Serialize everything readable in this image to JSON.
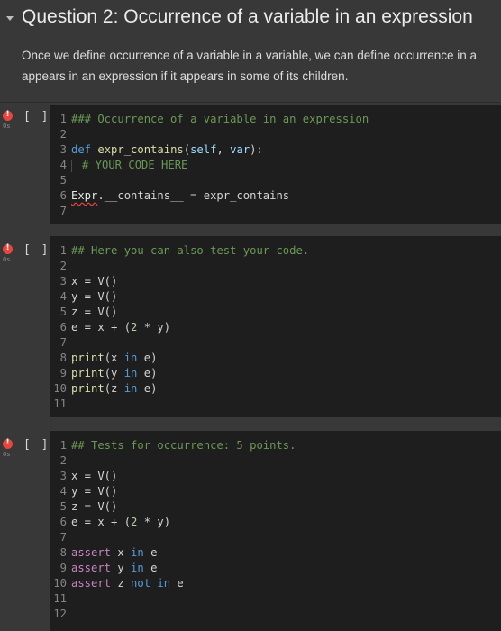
{
  "heading": {
    "title": "Question 2: Occurrence of a variable in an expression",
    "desc_line1": "Once we define occurrence of a variable in a variable, we can define occurrence in a",
    "desc_line2": "appears in an expression if it appears in some of its children."
  },
  "cells": [
    {
      "bracket": "[ ]",
      "time": "0s",
      "lines": [
        {
          "n": "1",
          "tokens": [
            {
              "t": "### Occurrence of a variable in an expression",
              "c": "comment"
            }
          ]
        },
        {
          "n": "2",
          "tokens": []
        },
        {
          "n": "3",
          "tokens": [
            {
              "t": "def ",
              "c": "def"
            },
            {
              "t": "expr_contains",
              "c": "fn"
            },
            {
              "t": "(",
              "c": "plain"
            },
            {
              "t": "self",
              "c": "self"
            },
            {
              "t": ", ",
              "c": "plain"
            },
            {
              "t": "var",
              "c": "self"
            },
            {
              "t": "):",
              "c": "plain"
            }
          ]
        },
        {
          "n": "4",
          "indent": true,
          "tokens": [
            {
              "t": "# YOUR CODE HERE",
              "c": "comment"
            }
          ]
        },
        {
          "n": "5",
          "tokens": []
        },
        {
          "n": "6",
          "tokens": [
            {
              "t": "Expr",
              "c": "squiggle"
            },
            {
              "t": ".__contains__ = expr_contains",
              "c": "plain"
            }
          ]
        },
        {
          "n": "7",
          "tokens": []
        }
      ]
    },
    {
      "bracket": "[ ]",
      "time": "0s",
      "lines": [
        {
          "n": "1",
          "tokens": [
            {
              "t": "## Here you can also test your code.",
              "c": "comment"
            }
          ]
        },
        {
          "n": "2",
          "tokens": []
        },
        {
          "n": "3",
          "tokens": [
            {
              "t": "x = V()",
              "c": "plain"
            }
          ]
        },
        {
          "n": "4",
          "tokens": [
            {
              "t": "y = V()",
              "c": "plain"
            }
          ]
        },
        {
          "n": "5",
          "tokens": [
            {
              "t": "z = V()",
              "c": "plain"
            }
          ]
        },
        {
          "n": "6",
          "tokens": [
            {
              "t": "e = x + (",
              "c": "plain"
            },
            {
              "t": "2",
              "c": "num"
            },
            {
              "t": " * y)",
              "c": "plain"
            }
          ]
        },
        {
          "n": "7",
          "tokens": []
        },
        {
          "n": "8",
          "tokens": [
            {
              "t": "print",
              "c": "fn"
            },
            {
              "t": "(x ",
              "c": "plain"
            },
            {
              "t": "in",
              "c": "def"
            },
            {
              "t": " e)",
              "c": "plain"
            }
          ]
        },
        {
          "n": "9",
          "tokens": [
            {
              "t": "print",
              "c": "fn"
            },
            {
              "t": "(y ",
              "c": "plain"
            },
            {
              "t": "in",
              "c": "def"
            },
            {
              "t": " e)",
              "c": "plain"
            }
          ]
        },
        {
          "n": "10",
          "tokens": [
            {
              "t": "print",
              "c": "fn"
            },
            {
              "t": "(z ",
              "c": "plain"
            },
            {
              "t": "in",
              "c": "def"
            },
            {
              "t": " e)",
              "c": "plain"
            }
          ]
        },
        {
          "n": "11",
          "tokens": []
        }
      ]
    },
    {
      "bracket": "[ ]",
      "time": "0s",
      "lines": [
        {
          "n": "1",
          "tokens": [
            {
              "t": "## Tests for occurrence: 5 points.",
              "c": "comment"
            }
          ]
        },
        {
          "n": "2",
          "tokens": []
        },
        {
          "n": "3",
          "tokens": [
            {
              "t": "x = V()",
              "c": "plain"
            }
          ]
        },
        {
          "n": "4",
          "tokens": [
            {
              "t": "y = V()",
              "c": "plain"
            }
          ]
        },
        {
          "n": "5",
          "tokens": [
            {
              "t": "z = V()",
              "c": "plain"
            }
          ]
        },
        {
          "n": "6",
          "tokens": [
            {
              "t": "e = x + (",
              "c": "plain"
            },
            {
              "t": "2",
              "c": "num"
            },
            {
              "t": " * y)",
              "c": "plain"
            }
          ]
        },
        {
          "n": "7",
          "tokens": []
        },
        {
          "n": "8",
          "tokens": [
            {
              "t": "assert",
              "c": "kw"
            },
            {
              "t": " x ",
              "c": "plain"
            },
            {
              "t": "in",
              "c": "def"
            },
            {
              "t": " e",
              "c": "plain"
            }
          ]
        },
        {
          "n": "9",
          "tokens": [
            {
              "t": "assert",
              "c": "kw"
            },
            {
              "t": " y ",
              "c": "plain"
            },
            {
              "t": "in",
              "c": "def"
            },
            {
              "t": " e",
              "c": "plain"
            }
          ]
        },
        {
          "n": "10",
          "tokens": [
            {
              "t": "assert",
              "c": "kw"
            },
            {
              "t": " z ",
              "c": "plain"
            },
            {
              "t": "not in",
              "c": "def"
            },
            {
              "t": " e",
              "c": "plain"
            }
          ]
        },
        {
          "n": "11",
          "tokens": []
        },
        {
          "n": "12",
          "tokens": []
        }
      ]
    }
  ]
}
